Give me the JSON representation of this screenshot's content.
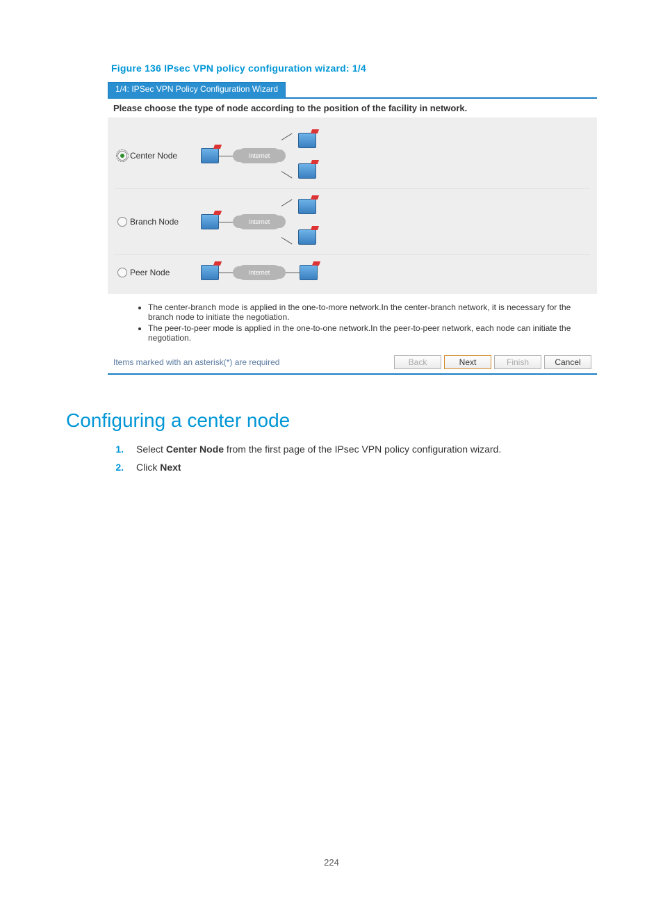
{
  "figure_caption": "Figure 136 IPsec VPN policy configuration wizard: 1/4",
  "wizard": {
    "tab_title": "1/4: IPSec VPN Policy Configuration Wizard",
    "instruction": "Please choose the type of node according to the position of the facility in network.",
    "nodes": {
      "center": {
        "label": "Center Node",
        "selected": true,
        "cloud": "Internet"
      },
      "branch": {
        "label": "Branch Node",
        "selected": false,
        "cloud": "Internet"
      },
      "peer": {
        "label": "Peer Node",
        "selected": false,
        "cloud": "Internet"
      }
    },
    "notes": {
      "a": "The center-branch mode is applied in the one-to-more network.In the center-branch network, it is necessary for the branch node to initiate the negotiation.",
      "b": "The peer-to-peer mode is applied in the one-to-one network.In the peer-to-peer network, each node can initiate the negotiation."
    },
    "footer_hint": "Items marked with an asterisk(*) are required",
    "buttons": {
      "back": "Back",
      "next": "Next",
      "finish": "Finish",
      "cancel": "Cancel"
    }
  },
  "section_heading": "Configuring a center node",
  "steps": {
    "s1a": "Select ",
    "s1b": "Center Node",
    "s1c": " from the first page of the IPsec VPN policy configuration wizard.",
    "s2a": "Click ",
    "s2b": "Next"
  },
  "nums": {
    "one": "1.",
    "two": "2."
  },
  "page_number": "224"
}
